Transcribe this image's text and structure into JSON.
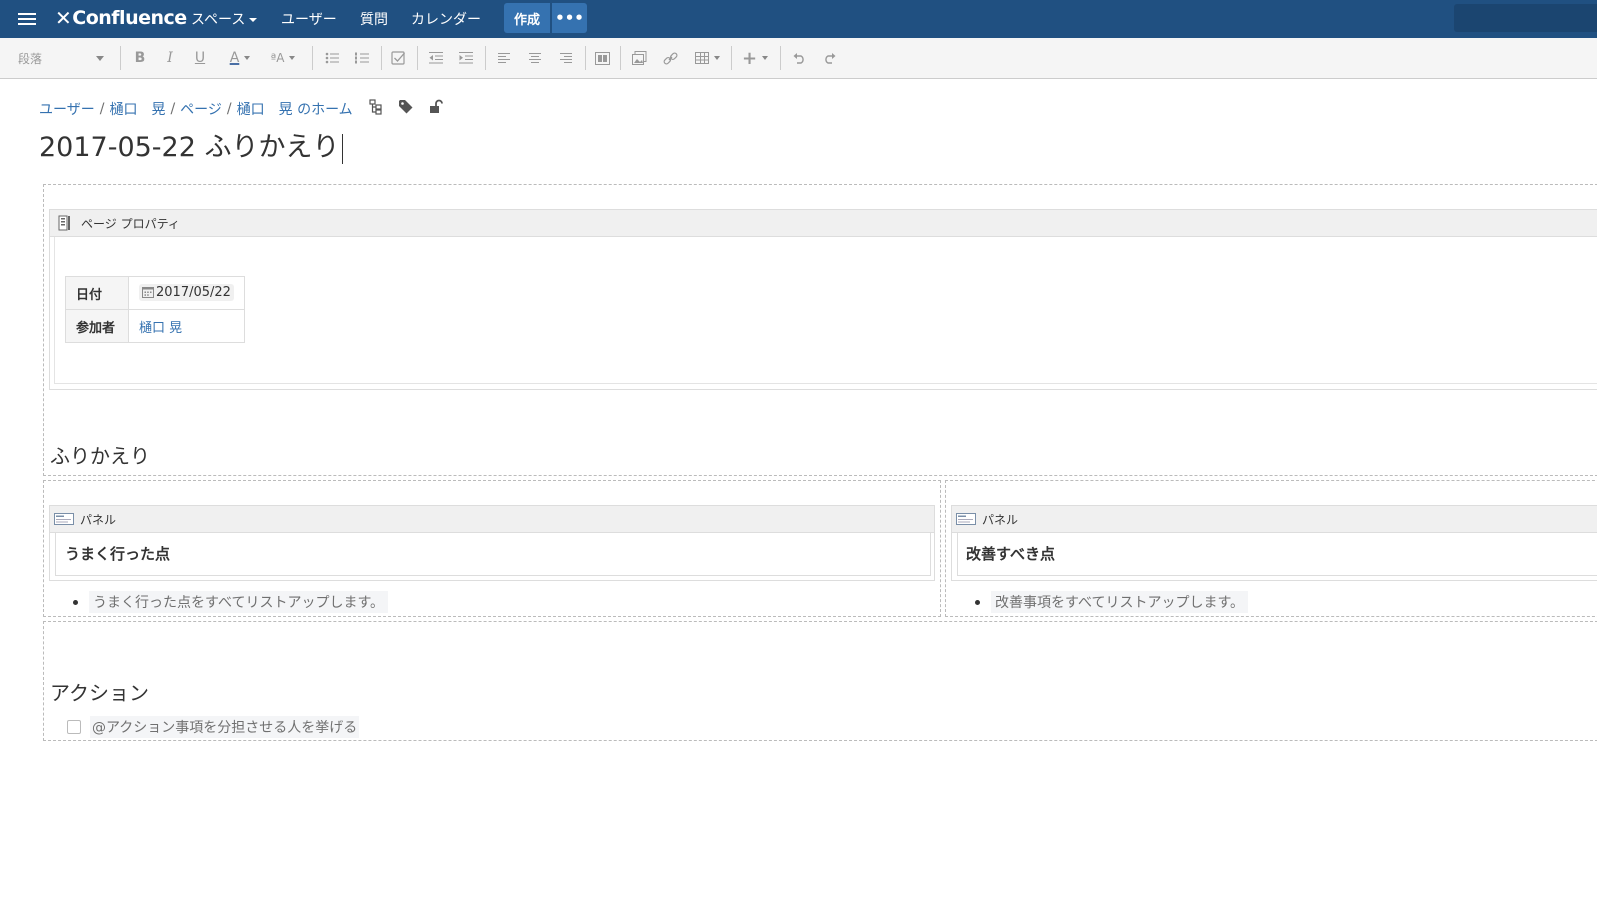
{
  "app": {
    "logo_text": "Confluence",
    "nav": {
      "spaces": "スペース",
      "users": "ユーザー",
      "questions": "質問",
      "calendar": "カレンダー"
    },
    "create_label": "作成",
    "more_label": "•••"
  },
  "toolbar": {
    "paragraph": "段落",
    "bold": "B",
    "italic": "I",
    "underline": "U",
    "text_color": "A",
    "text_format": "ªA",
    "insert": "+"
  },
  "breadcrumb": {
    "users": "ユーザー",
    "user_name": "樋口　晃",
    "pages": "ページ",
    "home": "樋口　晃 のホーム"
  },
  "page": {
    "title": "2017-05-22 ふりかえり"
  },
  "page_properties": {
    "macro_label": "ページ プロパティ",
    "date_label": "日付",
    "date_value": "2017/05/22",
    "participants_label": "参加者",
    "participant": "樋口 晃"
  },
  "retro": {
    "heading": "ふりかえり",
    "panel_label": "パネル",
    "good_title": "うまく行った点",
    "good_item": "うまく行った点をすべてリストアップします。",
    "improve_title": "改善すべき点",
    "improve_item": "改善事項をすべてリストアップします。"
  },
  "actions": {
    "heading": "アクション",
    "task_placeholder": "@アクション事項を分担させる人を挙げる"
  }
}
